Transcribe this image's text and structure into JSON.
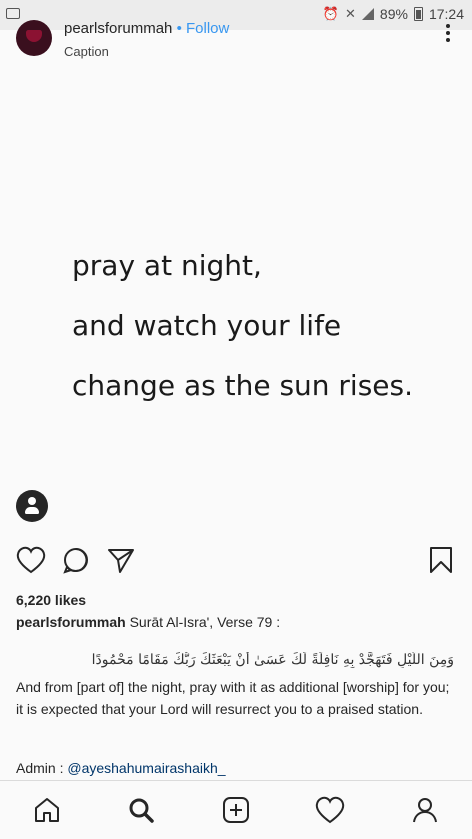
{
  "status_bar": {
    "battery": "89%",
    "time": "17:24"
  },
  "post": {
    "username": "pearlsforummah",
    "follow_label": "• Follow",
    "caption_label": "Caption",
    "quote_lines": [
      "pray at night,",
      "and watch your life",
      "change as the sun rises."
    ]
  },
  "engagement": {
    "likes": "6,220 likes",
    "caption_user": "pearlsforummah",
    "caption_text": "Surāt Al-Isra', Verse 79 :",
    "arabic": "وَمِنَ اللَّيْلِ فَتَهَجَّدْ بِهِ نَافِلَةً لَكَ عَسَىٰ أَنْ يَبْعَثَكَ رَبُّكَ مَقَامًا مَحْمُودًا",
    "translation": "And from [part of] the night, pray with it as additional [worship] for you; it is expected that your Lord will resurrect you to a praised station.",
    "admin_label": "Admin :",
    "admin_mention": "@ayeshahumairashaikh_"
  },
  "icons": {
    "heart": "heart-icon",
    "comment": "comment-icon",
    "share": "paper-plane-icon",
    "save": "bookmark-icon",
    "home": "home-icon",
    "search": "search-icon",
    "add": "add-post-icon",
    "activity": "heart-icon",
    "profile": "profile-icon"
  }
}
